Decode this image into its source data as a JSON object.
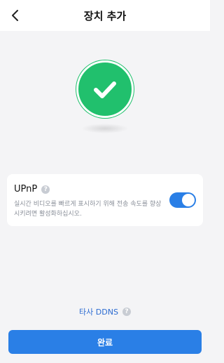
{
  "header": {
    "title": "장치 추가",
    "back_icon": "chevron-left-icon"
  },
  "status": {
    "icon": "checkmark-icon",
    "color": "#21c06d"
  },
  "upnp": {
    "title": "UPnP",
    "description": "실시간 비디오를 빠르게 표시하기 위해 전송 속도를 향상시키려면 활성화하십시오.",
    "enabled": true,
    "help_icon": "question-icon"
  },
  "ddns": {
    "label": "타사 DDNS",
    "help_icon": "question-icon"
  },
  "footer": {
    "done_label": "완료"
  },
  "colors": {
    "accent": "#2a7fe6",
    "success": "#21c06d",
    "background": "#f4f4f6"
  }
}
